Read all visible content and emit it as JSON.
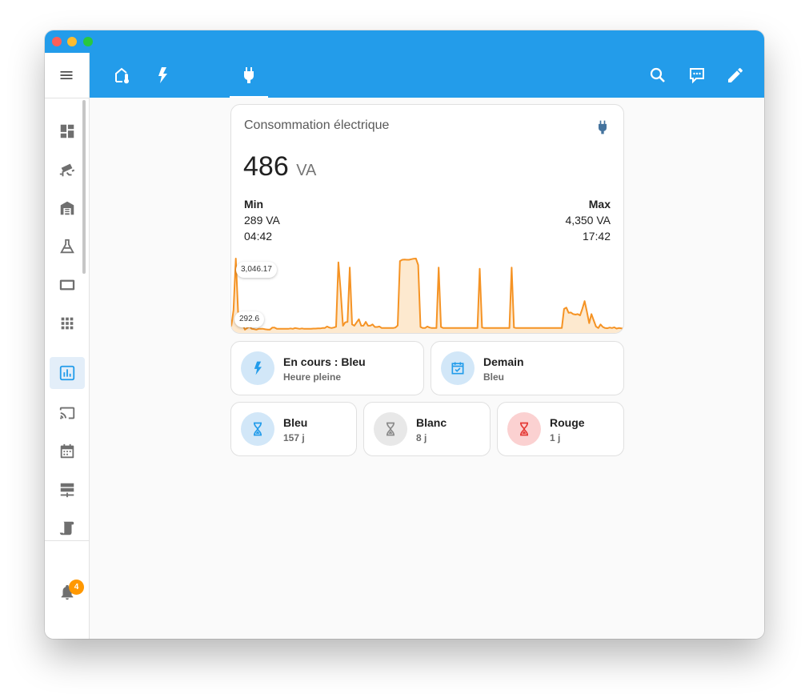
{
  "colors": {
    "accent": "#239cea",
    "chart_line": "#f59324",
    "chart_fill": "#fde9cf",
    "blue_state": "#239cea",
    "white_state": "#8a8a8a",
    "red_state": "#e53935",
    "badge": "#ff9800"
  },
  "window": {
    "traffic_lights": [
      "close",
      "minimize",
      "zoom"
    ]
  },
  "topbar": {
    "tabs": [
      {
        "icon": "home-thermometer-icon",
        "active": false
      },
      {
        "icon": "lightning-bolt-icon",
        "active": false
      },
      {
        "icon": "power-plug-icon",
        "active": true
      }
    ],
    "actions": [
      {
        "icon": "search-icon"
      },
      {
        "icon": "assist-chat-icon"
      },
      {
        "icon": "pencil-edit-icon"
      }
    ]
  },
  "sidebar": {
    "menu_icon": "hamburger-menu-icon",
    "items": [
      {
        "icon": "dashboard-icon",
        "active": false
      },
      {
        "icon": "cctv-icon",
        "active": false
      },
      {
        "icon": "garage-icon",
        "active": false
      },
      {
        "icon": "flask-icon",
        "active": false
      },
      {
        "icon": "tablet-icon",
        "active": false
      },
      {
        "icon": "apps-grid-icon",
        "active": false
      },
      {
        "icon": "chart-box-icon",
        "active": true
      },
      {
        "icon": "cast-icon",
        "active": false
      },
      {
        "icon": "calendar-icon",
        "active": false
      },
      {
        "icon": "server-network-icon",
        "active": false
      },
      {
        "icon": "script-icon",
        "active": false
      }
    ],
    "notifications": {
      "icon": "bell-icon",
      "count": "4"
    }
  },
  "energy_card": {
    "title": "Consommation électrique",
    "icon": "power-plug-icon",
    "value": "486",
    "unit": "VA",
    "min": {
      "label": "Min",
      "value": "289 VA",
      "time": "04:42"
    },
    "max": {
      "label": "Max",
      "value": "4,350 VA",
      "time": "17:42"
    },
    "chart_max_label": "3,046.17",
    "chart_min_label": "292.6"
  },
  "chart_data": {
    "type": "area",
    "title": "",
    "xlabel": "",
    "ylabel": "",
    "y_extent_labels": [
      "3,046.17",
      "292.6"
    ],
    "ylim": [
      292.6,
      3046.17
    ],
    "values": [
      420,
      1050,
      3046,
      1000,
      450,
      500,
      300,
      360,
      420,
      330,
      320,
      300,
      330,
      330,
      330,
      310,
      300,
      300,
      380,
      380,
      330,
      330,
      330,
      330,
      330,
      330,
      345,
      330,
      360,
      345,
      330,
      345,
      330,
      330,
      330,
      330,
      340,
      340,
      345,
      345,
      360,
      360,
      420,
      380,
      360,
      380,
      410,
      2900,
      1800,
      450,
      580,
      600,
      2700,
      500,
      450,
      580,
      700,
      450,
      450,
      600,
      450,
      450,
      500,
      400,
      400,
      420,
      360,
      360,
      360,
      360,
      360,
      360,
      380,
      460,
      2950,
      3000,
      3010,
      3000,
      3000,
      3020,
      3040,
      3046,
      2800,
      400,
      360,
      360,
      420,
      380,
      360,
      360,
      360,
      2700,
      400,
      360,
      360,
      360,
      360,
      360,
      360,
      360,
      360,
      360,
      360,
      360,
      360,
      360,
      360,
      360,
      360,
      2650,
      380,
      360,
      360,
      360,
      360,
      360,
      360,
      360,
      360,
      360,
      360,
      360,
      360,
      2700,
      380,
      360,
      360,
      360,
      360,
      360,
      360,
      360,
      360,
      360,
      360,
      360,
      360,
      360,
      360,
      360,
      360,
      360,
      360,
      360,
      360,
      360,
      1100,
      1150,
      950,
      960,
      900,
      880,
      900,
      850,
      1100,
      1400,
      1000,
      550,
      900,
      650,
      420,
      360,
      500,
      400,
      360,
      350,
      380,
      360,
      390,
      340,
      360,
      350,
      330
    ]
  },
  "tiles": [
    {
      "title": "En cours : Bleu",
      "subtitle": "Heure pleine",
      "icon": "flash-icon",
      "tone": "blue"
    },
    {
      "title": "Demain",
      "subtitle": "Bleu",
      "icon": "calendar-check-icon",
      "tone": "blue"
    },
    {
      "title": "Bleu",
      "subtitle": "157 j",
      "icon": "hourglass-icon",
      "tone": "blue"
    },
    {
      "title": "Blanc",
      "subtitle": "8 j",
      "icon": "hourglass-icon",
      "tone": "grey"
    },
    {
      "title": "Rouge",
      "subtitle": "1 j",
      "icon": "hourglass-icon",
      "tone": "red"
    }
  ]
}
